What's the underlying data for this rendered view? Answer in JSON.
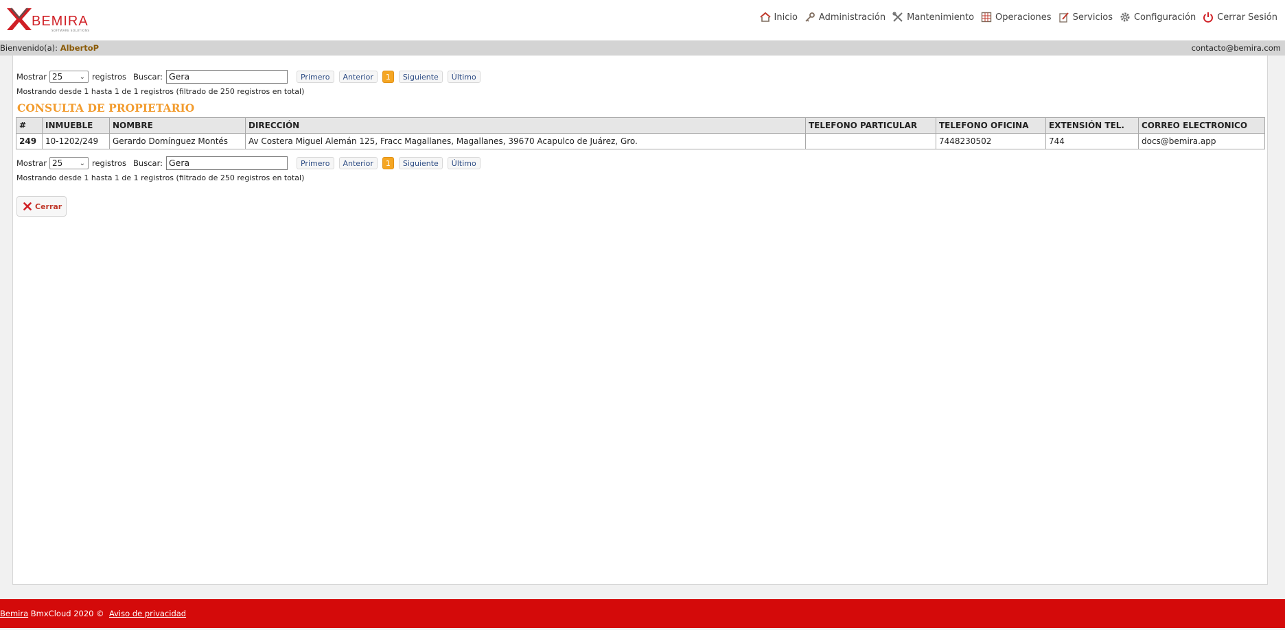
{
  "header": {
    "logo_text": "BEMIRA",
    "logo_subtitle": "SOFTWARE SOLUTIONS",
    "nav": [
      {
        "label": "Inicio",
        "icon": "home-icon"
      },
      {
        "label": "Administración",
        "icon": "key-icon"
      },
      {
        "label": "Mantenimiento",
        "icon": "tools-icon"
      },
      {
        "label": "Operaciones",
        "icon": "grid-icon"
      },
      {
        "label": "Servicios",
        "icon": "edit-icon"
      },
      {
        "label": "Configuración",
        "icon": "gear-icon"
      },
      {
        "label": "Cerrar Sesión",
        "icon": "power-icon"
      }
    ]
  },
  "welcome": {
    "label": "Bienvenido(a):",
    "user": "AlbertoP",
    "email": "contacto@bemira.com"
  },
  "controls": {
    "show_label": "Mostrar",
    "page_size": "25",
    "records_label": "registros",
    "search_label": "Buscar:",
    "search_value": "Gera",
    "pagination": {
      "first": "Primero",
      "prev": "Anterior",
      "current": "1",
      "next": "Siguiente",
      "last": "Último"
    },
    "info": "Mostrando desde 1 hasta 1 de 1 registros (filtrado de 250 registros en total)"
  },
  "title": "CONSULTA DE PROPIETARIO",
  "table": {
    "headers": [
      "#",
      "INMUEBLE",
      "NOMBRE",
      "DIRECCIÓN",
      "TELEFONO PARTICULAR",
      "TELEFONO OFICINA",
      "EXTENSIÓN TEL.",
      "CORREO ELECTRONICO"
    ],
    "rows": [
      [
        "249",
        "10-1202/249",
        "Gerardo Domínguez Montés",
        "Av Costera Miguel Alemán 125, Fracc Magallanes, Magallanes, 39670 Acapulco de Juárez, Gro.",
        "",
        "7448230502",
        "744",
        "docs@bemira.app"
      ]
    ]
  },
  "close_button": "Cerrar",
  "footer": {
    "brand_link": "Bemira",
    "text": " BmxCloud 2020 © ",
    "privacy_link": "Aviso de privacidad"
  },
  "colors": {
    "brand_red": "#d40a0a",
    "title_orange": "#f29c2f",
    "current_page": "#f5a623"
  }
}
